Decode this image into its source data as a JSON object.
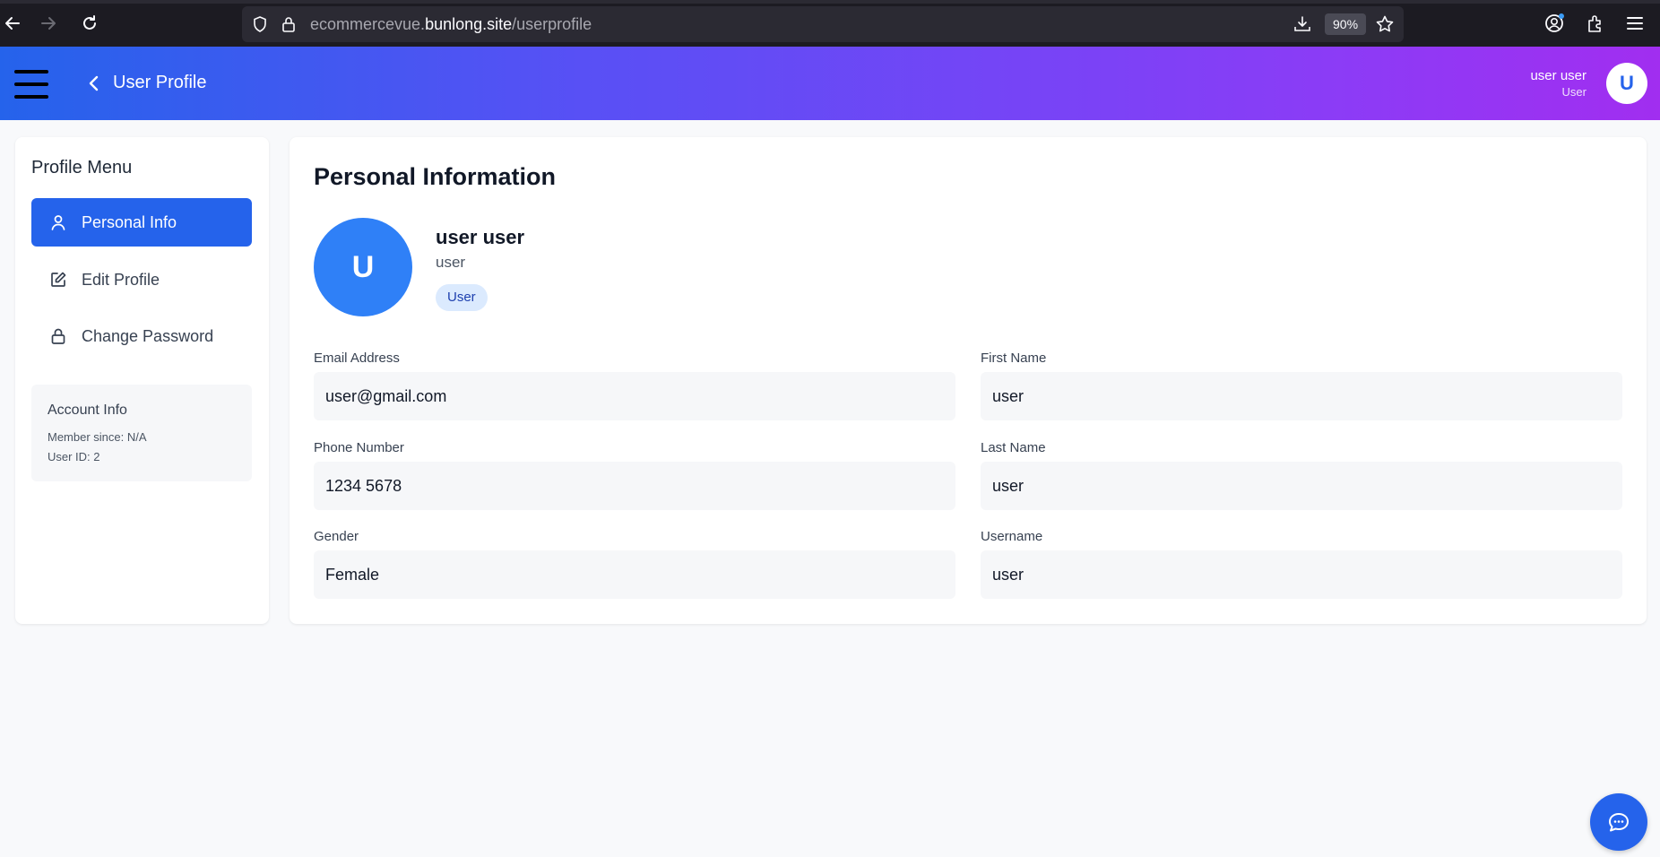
{
  "browser": {
    "url_prefix": "ecommercevue.",
    "url_host": "bunlong.site",
    "url_path": "/userprofile",
    "zoom": "90%",
    "icons": [
      "back-arrow-icon",
      "forward-arrow-icon",
      "reload-icon",
      "shield-icon",
      "lock-icon",
      "download-icon",
      "bookmark-star-icon",
      "account-icon",
      "extensions-icon",
      "menu-icon"
    ]
  },
  "header": {
    "title": "User Profile",
    "user_name": "user user",
    "user_role": "User",
    "avatar_letter": "U",
    "gradient": [
      "#2563eb",
      "#a12ef0"
    ]
  },
  "sidebar": {
    "title": "Profile Menu",
    "items": [
      {
        "label": "Personal Info",
        "icon": "user-icon",
        "active": true
      },
      {
        "label": "Edit Profile",
        "icon": "edit-icon",
        "active": false
      },
      {
        "label": "Change Password",
        "icon": "lock-icon",
        "active": false
      }
    ],
    "account": {
      "title": "Account Info",
      "member_since": "Member since: N/A",
      "user_id": "User ID: 2"
    }
  },
  "main": {
    "title": "Personal Information",
    "avatar_letter": "U",
    "full_name": "user user",
    "username": "user",
    "role_badge": "User",
    "fields": {
      "email": {
        "label": "Email Address",
        "value": "user@gmail.com"
      },
      "first_name": {
        "label": "First Name",
        "value": "user"
      },
      "phone": {
        "label": "Phone Number",
        "value": "1234 5678"
      },
      "last_name": {
        "label": "Last Name",
        "value": "user"
      },
      "gender": {
        "label": "Gender",
        "value": "Female"
      },
      "username": {
        "label": "Username",
        "value": "user"
      }
    }
  },
  "colors": {
    "accent": "#2563eb",
    "page_bg": "#f8f9fb"
  }
}
